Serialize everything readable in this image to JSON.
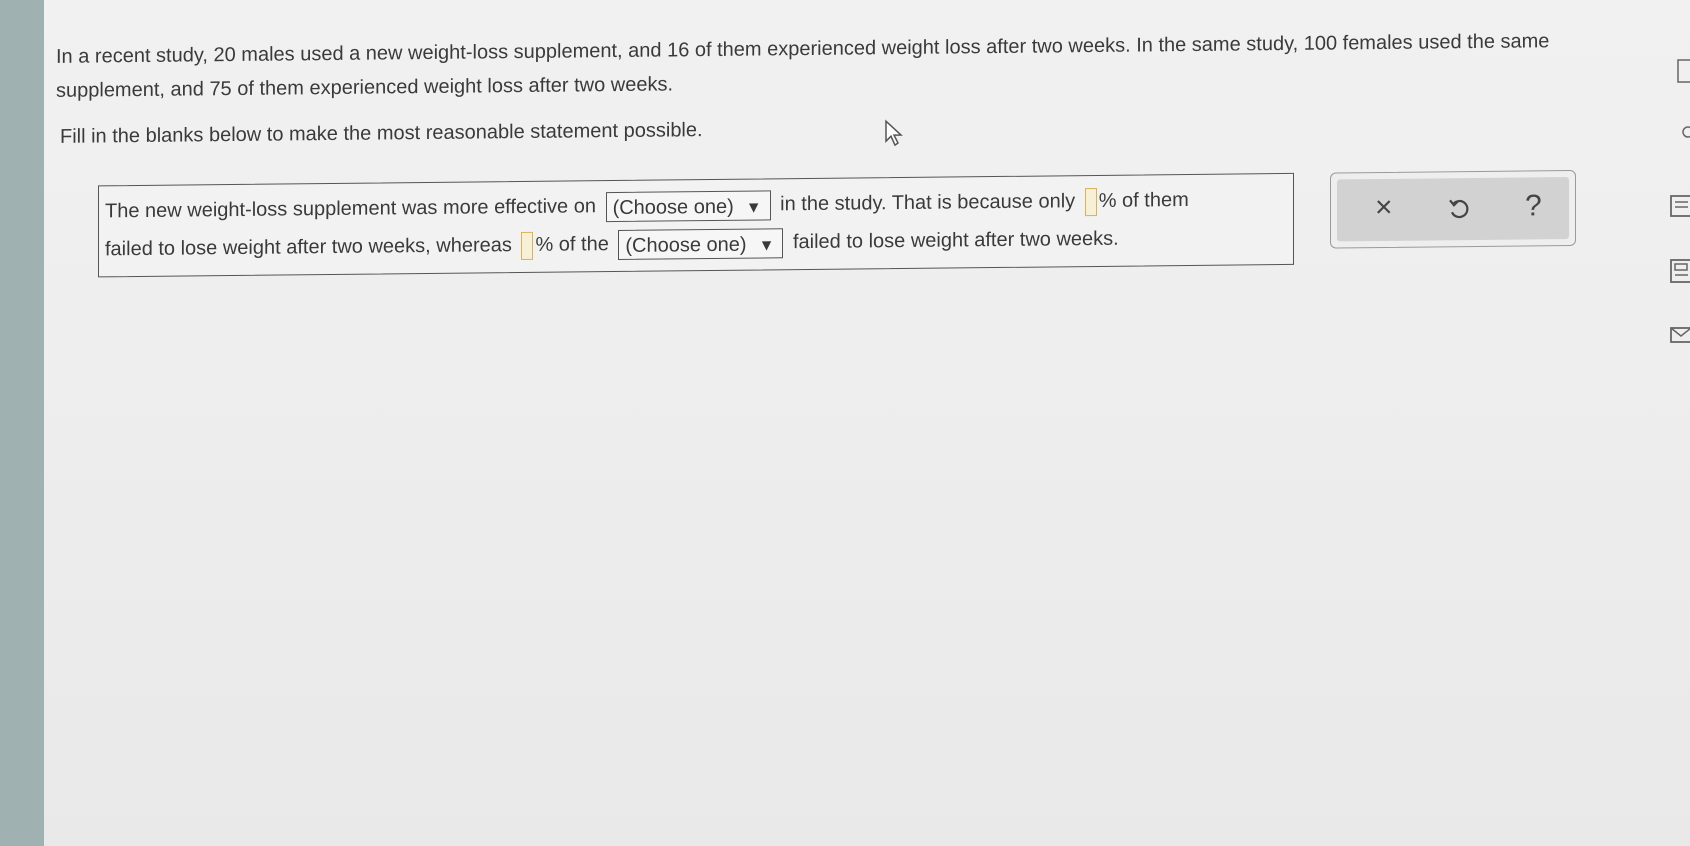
{
  "problem": {
    "text": "In a recent study, 20 males used a new weight-loss supplement, and 16 of them experienced weight loss after two weeks. In the same study, 100 females used the same supplement, and 75 of them experienced weight loss after two weeks.",
    "instruction": "Fill in the blanks below to make the most reasonable statement possible."
  },
  "statement": {
    "part1": "The new weight-loss supplement was more effective on",
    "select1": "(Choose one)",
    "part2": "in the study. That is because only",
    "pct1_suffix": "% of them",
    "part3": "failed to lose weight after two weeks, whereas",
    "pct2_suffix": "% of the",
    "select2": "(Choose one)",
    "part4": "failed to lose weight after two weeks."
  },
  "icons": {
    "dropdown": "▼",
    "clear": "×",
    "undo": "↺",
    "help": "?"
  }
}
